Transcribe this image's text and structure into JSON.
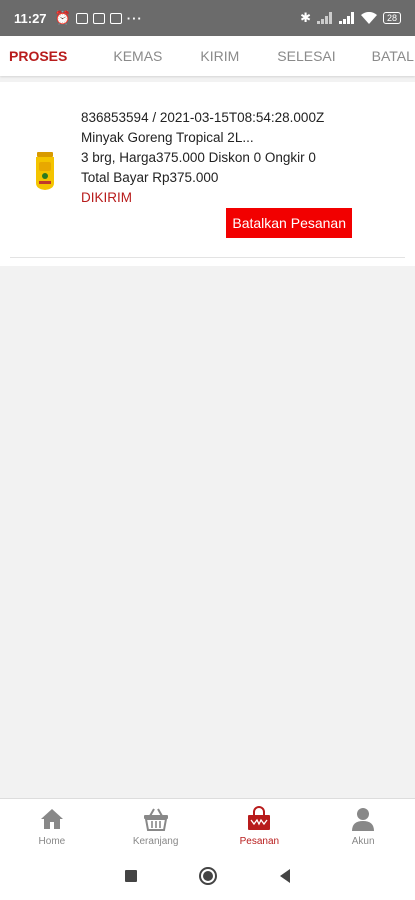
{
  "status_bar": {
    "time": "11:27",
    "battery": "28"
  },
  "tabs": [
    {
      "label": "PROSES",
      "active": true
    },
    {
      "label": "KEMAS",
      "active": false
    },
    {
      "label": "KIRIM",
      "active": false
    },
    {
      "label": "SELESAI",
      "active": false
    },
    {
      "label": "BATAL",
      "active": false
    }
  ],
  "order": {
    "id_line": "836853594 / 2021-03-15T08:54:28.000Z",
    "product_name": "Minyak Goreng Tropical 2L...",
    "detail_line": "3 brg, Harga375.000 Diskon 0 Ongkir 0",
    "total_line": "Total Bayar Rp375.000",
    "status": "DIKIRIM",
    "cancel_label": "Batalkan Pesanan"
  },
  "bottom_nav": [
    {
      "label": "Home",
      "icon": "home-icon"
    },
    {
      "label": "Keranjang",
      "icon": "basket-icon"
    },
    {
      "label": "Pesanan",
      "icon": "bag-icon",
      "active": true
    },
    {
      "label": "Akun",
      "icon": "user-icon"
    }
  ],
  "colors": {
    "accent": "#b81c1c",
    "button": "#f20000"
  }
}
